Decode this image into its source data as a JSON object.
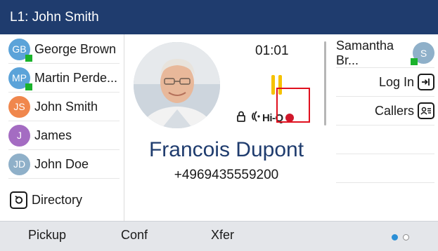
{
  "header": {
    "line_title": "L1: John Smith"
  },
  "left_keys": [
    {
      "label": "George Brown",
      "initials": "GB",
      "color": "#5ba3d9",
      "presence": "available"
    },
    {
      "label": "Martin Perde...",
      "initials": "MP",
      "color": "#5ba3d9",
      "presence": "available"
    },
    {
      "label": "John Smith",
      "initials": "JS",
      "color": "#f0874d",
      "presence": ""
    },
    {
      "label": "James",
      "initials": "J",
      "color": "#a46cc2",
      "presence": ""
    },
    {
      "label": "John Doe",
      "initials": "JD",
      "color": "#8fb0c9",
      "presence": ""
    },
    {
      "label": "Directory",
      "icon": "directory-icon"
    }
  ],
  "call": {
    "timer": "01:01",
    "caller_name": "Francois Dupont",
    "caller_number": "+4969435559200",
    "hq_label": "Hi-Q",
    "icons": [
      "lock-icon",
      "audio-waves-icon",
      "record-icon"
    ],
    "hold_color": "#f5c200",
    "record_color": "#d0172b"
  },
  "right_keys": [
    {
      "label": "Samantha Br...",
      "initials": "S",
      "color": "#8fb0c9",
      "presence": "available"
    },
    {
      "label": "Log In",
      "icon": "login-icon"
    },
    {
      "label": "Callers",
      "icon": "callers-icon"
    }
  ],
  "softkeys": [
    "Pickup",
    "Conf",
    "Xfer"
  ],
  "pagination": {
    "current_page": 1,
    "total_pages": 2
  },
  "colors": {
    "header_bg": "#1f3c6e",
    "accent": "#1f3c6e",
    "presence": "#1bb32c",
    "highlight": "#e0101e"
  }
}
